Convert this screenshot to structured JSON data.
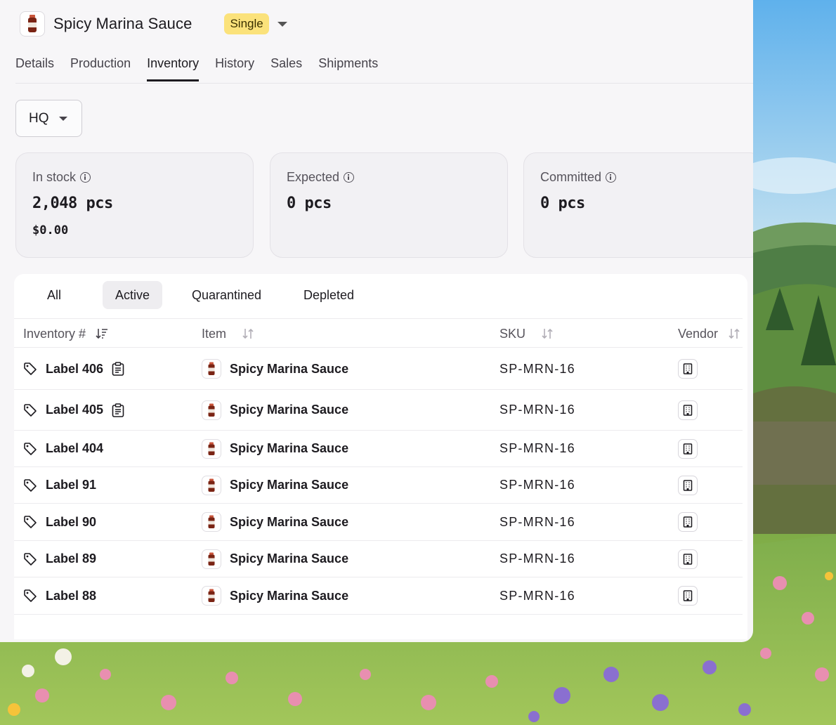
{
  "header": {
    "product_name": "Spicy Marina Sauce",
    "variant_badge": "Single"
  },
  "tabs": [
    {
      "label": "Details"
    },
    {
      "label": "Production"
    },
    {
      "label": "Inventory",
      "active": true
    },
    {
      "label": "History"
    },
    {
      "label": "Sales"
    },
    {
      "label": "Shipments"
    }
  ],
  "location": {
    "value": "HQ"
  },
  "stats": [
    {
      "label": "In stock",
      "value": "2,048 pcs",
      "money": "$0.00"
    },
    {
      "label": "Expected",
      "value": "0 pcs"
    },
    {
      "label": "Committed",
      "value": "0 pcs"
    }
  ],
  "filters": [
    {
      "label": "All"
    },
    {
      "label": "Active",
      "active": true
    },
    {
      "label": "Quarantined"
    },
    {
      "label": "Depleted"
    }
  ],
  "columns": {
    "inventory": "Inventory #",
    "item": "Item",
    "sku": "SKU",
    "vendor": "Vendor"
  },
  "rows": [
    {
      "label": "Label 406",
      "item": "Spicy Marina Sauce",
      "sku": "SP-MRN-16",
      "has_note": true
    },
    {
      "label": "Label 405",
      "item": "Spicy Marina Sauce",
      "sku": "SP-MRN-16",
      "has_note": true
    },
    {
      "label": "Label 404",
      "item": "Spicy Marina Sauce",
      "sku": "SP-MRN-16",
      "has_note": false
    },
    {
      "label": "Label 91",
      "item": "Spicy Marina Sauce",
      "sku": "SP-MRN-16",
      "has_note": false
    },
    {
      "label": "Label 90",
      "item": "Spicy Marina Sauce",
      "sku": "SP-MRN-16",
      "has_note": false
    },
    {
      "label": "Label 89",
      "item": "Spicy Marina Sauce",
      "sku": "SP-MRN-16",
      "has_note": false
    },
    {
      "label": "Label 88",
      "item": "Spicy Marina Sauce",
      "sku": "SP-MRN-16",
      "has_note": false
    }
  ],
  "colors": {
    "badge": "#fbe27b",
    "text": "#1d1b20",
    "muted": "#56535b",
    "background": "#f7f6f8"
  },
  "icons": [
    "sauce-jar-icon",
    "chevron-down-icon",
    "info-icon",
    "sort-icon",
    "tag-icon",
    "clipboard-icon",
    "building-icon"
  ]
}
